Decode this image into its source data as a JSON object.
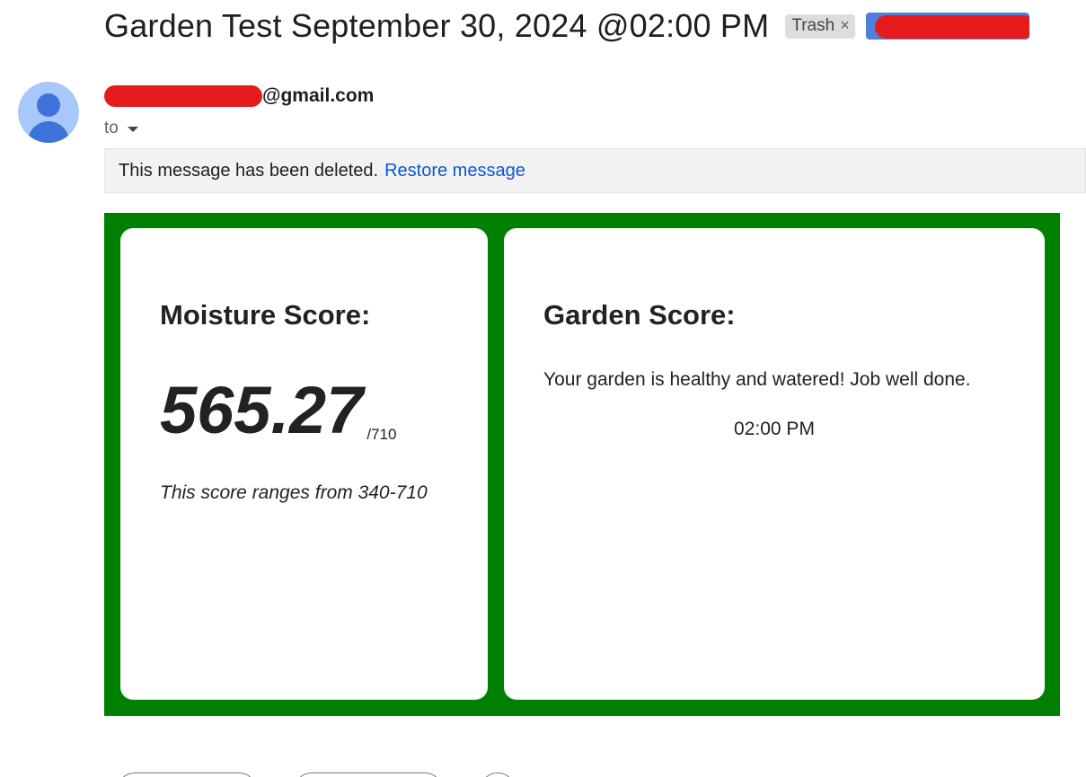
{
  "subject": {
    "title": "Garden Test September 30, 2024 @02:00 PM",
    "labels": [
      {
        "text": "Trash",
        "remove_glyph": "×"
      }
    ],
    "redacted_label_color": "#4f7fdc"
  },
  "sender": {
    "email_suffix": "@gmail.com",
    "to_label": "to",
    "avatar_icon": "person-avatar-icon"
  },
  "banner": {
    "message": "This message has been deleted.",
    "restore_link": "Restore message"
  },
  "email_body": {
    "background_color": "#008000",
    "moisture": {
      "title": "Moisture Score:",
      "score": "565.27",
      "max": "/710",
      "range_text": "This score ranges from 340-710"
    },
    "garden": {
      "title": "Garden Score:",
      "message": "Your garden is healthy and watered! Job well done.",
      "time": "02:00 PM"
    }
  },
  "colors": {
    "link": "#0b57d0",
    "redaction": "#e51b1b",
    "avatar_bg": "#a8c7fa",
    "avatar_fg": "#3e73d9"
  }
}
